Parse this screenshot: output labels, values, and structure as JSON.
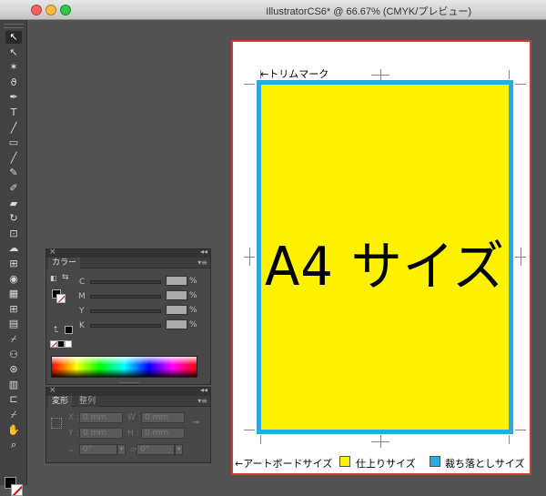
{
  "window": {
    "title": "IllustratorCS6* @ 66.67% (CMYK/プレビュー)",
    "buttons": {
      "close_color": "#fc605c",
      "minimize_color": "#fdbc40",
      "zoom_color": "#34c84a"
    }
  },
  "toolbar": {
    "tools": [
      {
        "name": "selection-tool-icon",
        "glyph": "↖"
      },
      {
        "name": "direct-selection-tool-icon",
        "glyph": "↖"
      },
      {
        "name": "magic-wand-tool-icon",
        "glyph": "✶"
      },
      {
        "name": "lasso-tool-icon",
        "glyph": "ϑ"
      },
      {
        "name": "pen-tool-icon",
        "glyph": "✒"
      },
      {
        "name": "type-tool-icon",
        "glyph": "T"
      },
      {
        "name": "line-tool-icon",
        "glyph": "╱"
      },
      {
        "name": "rectangle-tool-icon",
        "glyph": "▭"
      },
      {
        "name": "paintbrush-tool-icon",
        "glyph": "╱"
      },
      {
        "name": "pencil-tool-icon",
        "glyph": "✎"
      },
      {
        "name": "blob-brush-tool-icon",
        "glyph": "✐"
      },
      {
        "name": "eraser-tool-icon",
        "glyph": "▰"
      },
      {
        "name": "rotate-tool-icon",
        "glyph": "↻"
      },
      {
        "name": "scale-tool-icon",
        "glyph": "⊡"
      },
      {
        "name": "warp-tool-icon",
        "glyph": "☁"
      },
      {
        "name": "free-transform-tool-icon",
        "glyph": "⊞"
      },
      {
        "name": "shape-builder-tool-icon",
        "glyph": "◉"
      },
      {
        "name": "perspective-grid-tool-icon",
        "glyph": "▦"
      },
      {
        "name": "mesh-tool-icon",
        "glyph": "⊞"
      },
      {
        "name": "gradient-tool-icon",
        "glyph": "▤"
      },
      {
        "name": "eyedropper-tool-icon",
        "glyph": "⌿"
      },
      {
        "name": "blend-tool-icon",
        "glyph": "⚇"
      },
      {
        "name": "symbol-sprayer-tool-icon",
        "glyph": "⊛"
      },
      {
        "name": "column-graph-tool-icon",
        "glyph": "▥"
      },
      {
        "name": "artboard-tool-icon",
        "glyph": "⊏"
      },
      {
        "name": "slice-tool-icon",
        "glyph": "⌿"
      },
      {
        "name": "hand-tool-icon",
        "glyph": "✋"
      },
      {
        "name": "zoom-tool-icon",
        "glyph": "⌕"
      }
    ]
  },
  "document": {
    "main_label": "A4 サイズ",
    "trim_mark_note": "←トリムマーク",
    "artboard_note": "←アートボードサイズ",
    "legend": [
      {
        "label": "仕上りサイズ",
        "color": "#fff200"
      },
      {
        "label": "裁ち落としサイズ",
        "color": "#29aae2"
      }
    ],
    "colors": {
      "trim": "#fff200",
      "bleed": "#29aae2",
      "artboard_border": "#d33333"
    }
  },
  "color_panel": {
    "tab": "カラー",
    "rows": [
      {
        "label": "C",
        "unit": "%"
      },
      {
        "label": "M",
        "unit": "%"
      },
      {
        "label": "Y",
        "unit": "%"
      },
      {
        "label": "K",
        "unit": "%"
      }
    ]
  },
  "transform_panel": {
    "tabs": [
      "変形",
      "整列"
    ],
    "x_label": "X :",
    "x_value": "0 mm",
    "w_label": "W :",
    "w_value": "0 mm",
    "y_label": "Y :",
    "y_value": "0 mm",
    "h_label": "H :",
    "h_value": "0 mm",
    "rotate_value": "0°",
    "shear_value": "0°"
  }
}
